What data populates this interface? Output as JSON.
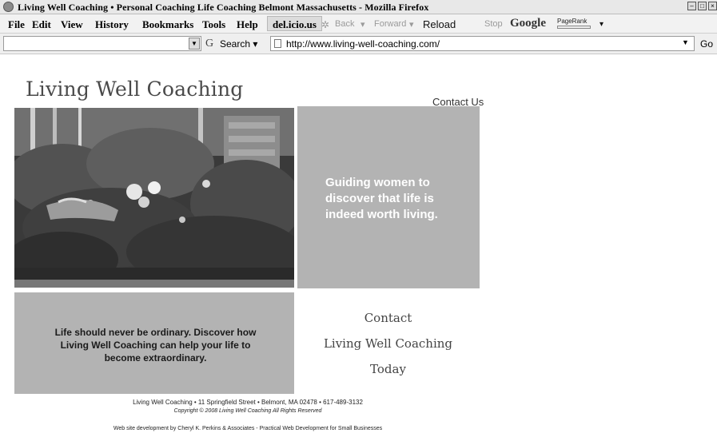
{
  "window": {
    "title": "Living Well Coaching • Personal Coaching Life Coaching Belmont Massachusetts - Mozilla Firefox"
  },
  "menubar": {
    "items": [
      {
        "label": "File"
      },
      {
        "label": "Edit"
      },
      {
        "label": "View"
      },
      {
        "label": "History"
      },
      {
        "label": "Bookmarks"
      },
      {
        "label": "Tools"
      },
      {
        "label": "Help"
      }
    ],
    "delicious": "del.icio.us",
    "back": "Back",
    "forward": "Forward",
    "reload": "Reload",
    "stop": "Stop",
    "google": "Google",
    "pagerank": "PageRank"
  },
  "addressbar": {
    "search_label": "Search",
    "url": "http://www.living-well-coaching.com/",
    "go": "Go"
  },
  "page": {
    "logo": "Living Well Coaching",
    "contact_link": "Contact Us",
    "tagline": "Guiding women to discover that life is indeed worth living.",
    "message": "Life should never be ordinary. Discover how Living Well Coaching can help your life to become extraordinary.",
    "contact_lines": [
      "Contact",
      "Living Well Coaching",
      "Today"
    ],
    "footer_address": "Living Well Coaching • 11 Springfield Street • Belmont, MA 02478 • 617-489-3132",
    "footer_copyright": "Copyright © 2008 Living Well Coaching All Rights Reserved",
    "footer_credit": "Web site development by Cheryl K. Perkins & Associates - Practical Web Development for Small Businesses"
  },
  "icons": {
    "app": "firefox-icon",
    "window_buttons": [
      "minimize-icon",
      "maximize-icon",
      "close-icon"
    ]
  },
  "colors": {
    "panel_gray": "#b3b3b3",
    "tagline_text": "#ffffff"
  }
}
